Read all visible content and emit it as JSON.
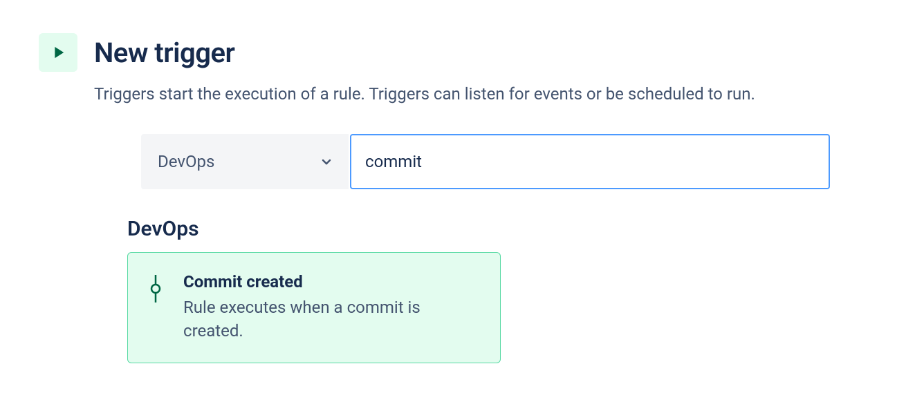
{
  "header": {
    "title": "New trigger",
    "subtitle": "Triggers start the execution of a rule. Triggers can listen for events or be scheduled to run."
  },
  "filter": {
    "dropdown_label": "DevOps",
    "search_value": "commit"
  },
  "category": {
    "title": "DevOps",
    "card": {
      "title": "Commit created",
      "description": "Rule executes when a commit is created."
    }
  }
}
